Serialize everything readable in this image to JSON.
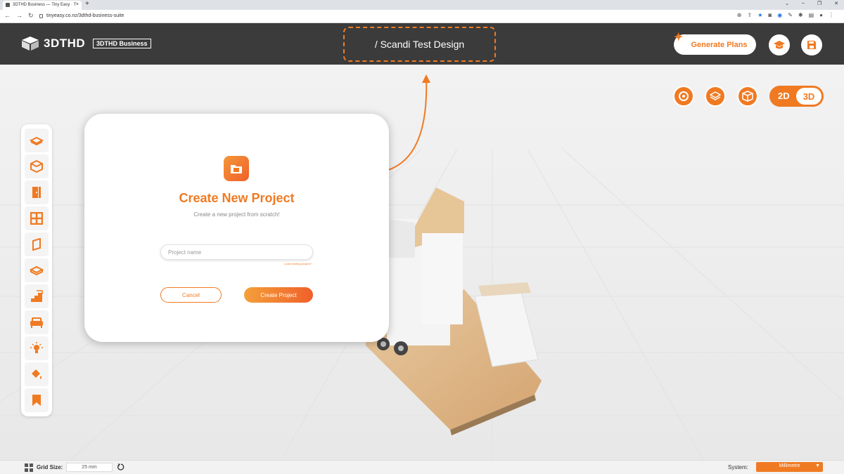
{
  "browser": {
    "tab_title": "3DTHD Business — Tiny Easy · T",
    "url": "tinyeasy.co.nz/3dthd-business-suite"
  },
  "header": {
    "brand": "3DTHD",
    "business_tag": "3DTHD Business",
    "project_title": "/ Scandi Test Design",
    "generate_plans_label": "Generate Plans"
  },
  "view_toggle": {
    "label_2d": "2D",
    "label_3d": "3D",
    "active": "3D"
  },
  "sidebar": {
    "items": [
      {
        "name": "floor-icon"
      },
      {
        "name": "walls-icon"
      },
      {
        "name": "door-icon"
      },
      {
        "name": "window-icon"
      },
      {
        "name": "cladding-icon"
      },
      {
        "name": "roof-icon"
      },
      {
        "name": "stairs-icon"
      },
      {
        "name": "furniture-icon"
      },
      {
        "name": "lighting-icon"
      },
      {
        "name": "paint-icon"
      },
      {
        "name": "bookmark-icon"
      }
    ]
  },
  "modal": {
    "title": "Create New Project",
    "subtitle": "Create a new project from scratch!",
    "input_placeholder": "Project name",
    "input_value": "",
    "load_link": "Load existing project?",
    "cancel_label": "Cancel",
    "create_label": "Create Project"
  },
  "bottom_bar": {
    "grid_label": "Grid Size:",
    "grid_value": "25 mm",
    "system_label": "System:",
    "system_value": "Millimetre"
  },
  "colors": {
    "accent": "#f07a22",
    "header_bg": "#3b3b3b"
  }
}
